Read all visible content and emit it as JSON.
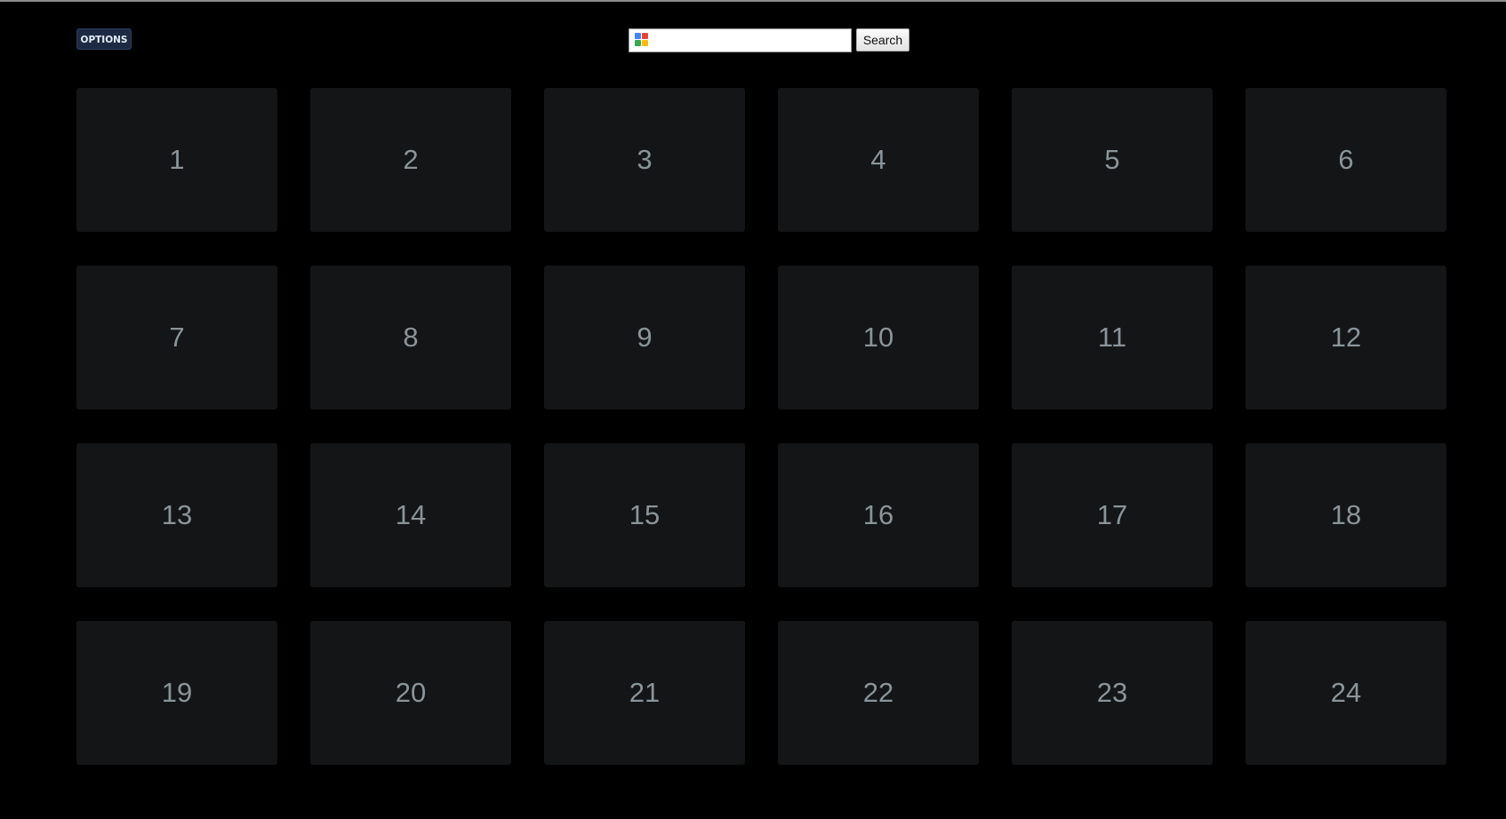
{
  "header": {
    "options_label": "OPTIONS",
    "search": {
      "value": "",
      "placeholder": "",
      "button_label": "Search",
      "icon": "google-icon"
    }
  },
  "tiles": [
    {
      "label": "1"
    },
    {
      "label": "2"
    },
    {
      "label": "3"
    },
    {
      "label": "4"
    },
    {
      "label": "5"
    },
    {
      "label": "6"
    },
    {
      "label": "7"
    },
    {
      "label": "8"
    },
    {
      "label": "9"
    },
    {
      "label": "10"
    },
    {
      "label": "11"
    },
    {
      "label": "12"
    },
    {
      "label": "13"
    },
    {
      "label": "14"
    },
    {
      "label": "15"
    },
    {
      "label": "16"
    },
    {
      "label": "17"
    },
    {
      "label": "18"
    },
    {
      "label": "19"
    },
    {
      "label": "20"
    },
    {
      "label": "21"
    },
    {
      "label": "22"
    },
    {
      "label": "23"
    },
    {
      "label": "24"
    }
  ],
  "colors": {
    "background": "#000000",
    "tile": "#141516",
    "tile_text": "#8a9499",
    "options_button": "#1c2a44"
  }
}
